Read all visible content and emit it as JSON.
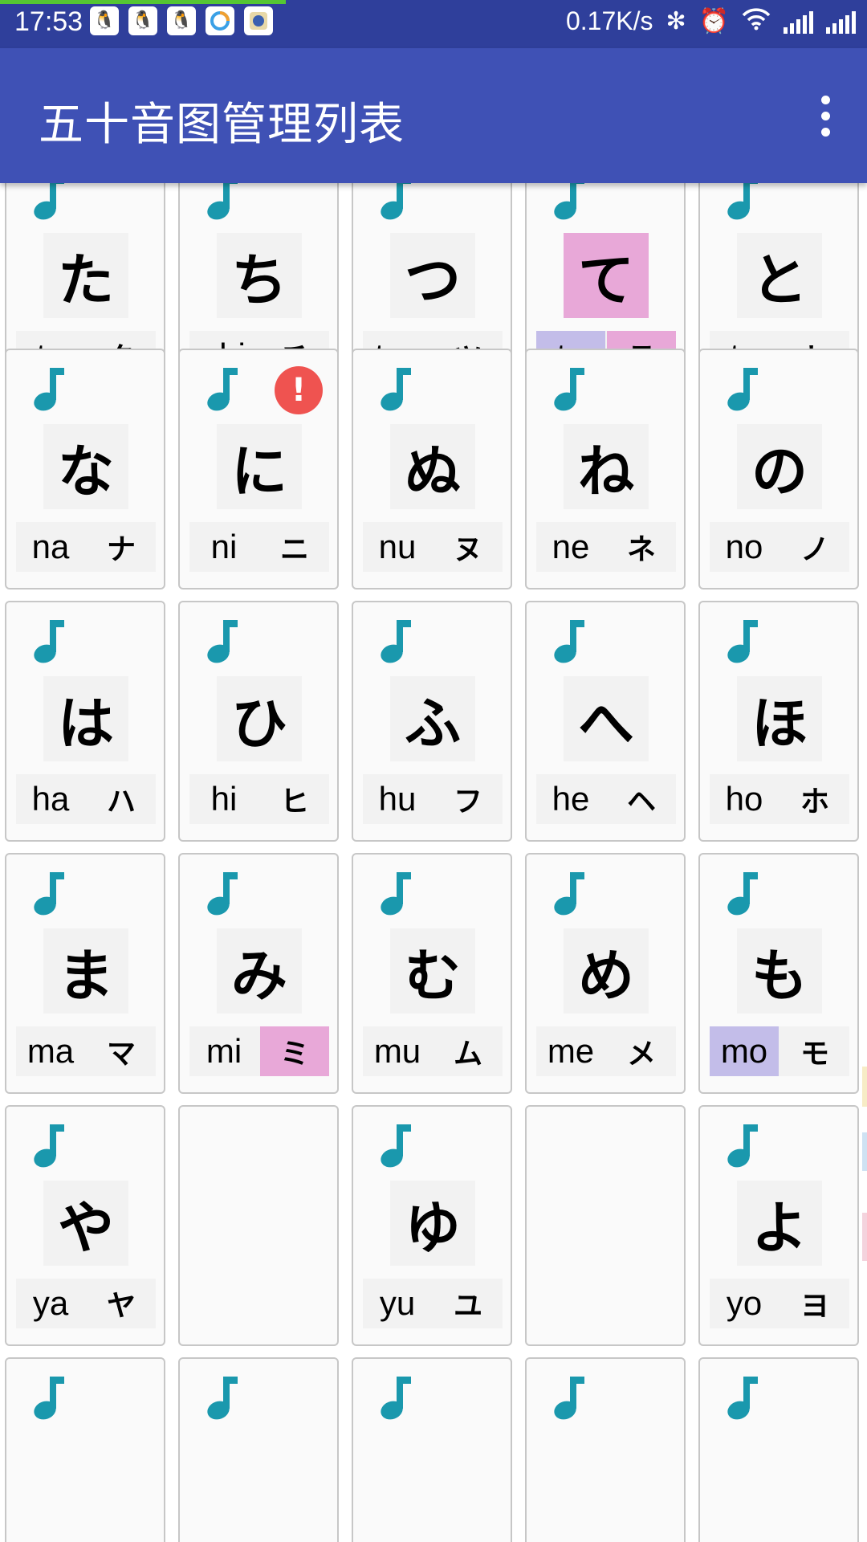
{
  "status_bar": {
    "time": "17:53",
    "progress": 0.33,
    "notification_icons": [
      "qq-icon",
      "qq-icon",
      "qq-icon",
      "ring-app-icon",
      "badge-app-icon"
    ],
    "net_speed": "0.17K/s",
    "bluetooth_glyph": "✻",
    "alarm_glyph": "⏰",
    "wifi_glyph": "◠",
    "background_color": "#2f3f9b",
    "progress_color": "#55c633"
  },
  "app_bar": {
    "title": "五十音图管理列表",
    "background_color": "#3f51b5"
  },
  "grid": {
    "note_color": "#1a98ad",
    "rows": [
      [
        {
          "empty": false,
          "hira": "た",
          "romaji": "ta",
          "kata": "タ"
        },
        {
          "empty": false,
          "hira": "ち",
          "romaji": "chi",
          "kata": "チ"
        },
        {
          "empty": false,
          "hira": "つ",
          "romaji": "tsu",
          "kata": "ツ"
        },
        {
          "empty": false,
          "hira": "て",
          "romaji": "te",
          "kata": "テ",
          "hira_hl": "pink",
          "romaji_hl": "lavender",
          "kata_hl": "pink"
        },
        {
          "empty": false,
          "hira": "と",
          "romaji": "to",
          "kata": "ト"
        }
      ],
      [
        {
          "empty": false,
          "hira": "な",
          "romaji": "na",
          "kata": "ナ"
        },
        {
          "empty": false,
          "hira": "に",
          "romaji": "ni",
          "kata": "ニ",
          "alert": "!"
        },
        {
          "empty": false,
          "hira": "ぬ",
          "romaji": "nu",
          "kata": "ヌ"
        },
        {
          "empty": false,
          "hira": "ね",
          "romaji": "ne",
          "kata": "ネ"
        },
        {
          "empty": false,
          "hira": "の",
          "romaji": "no",
          "kata": "ノ"
        }
      ],
      [
        {
          "empty": false,
          "hira": "は",
          "romaji": "ha",
          "kata": "ハ"
        },
        {
          "empty": false,
          "hira": "ひ",
          "romaji": "hi",
          "kata": "ヒ"
        },
        {
          "empty": false,
          "hira": "ふ",
          "romaji": "hu",
          "kata": "フ"
        },
        {
          "empty": false,
          "hira": "へ",
          "romaji": "he",
          "kata": "ヘ"
        },
        {
          "empty": false,
          "hira": "ほ",
          "romaji": "ho",
          "kata": "ホ"
        }
      ],
      [
        {
          "empty": false,
          "hira": "ま",
          "romaji": "ma",
          "kata": "マ"
        },
        {
          "empty": false,
          "hira": "み",
          "romaji": "mi",
          "kata": "ミ",
          "kata_hl": "pink"
        },
        {
          "empty": false,
          "hira": "む",
          "romaji": "mu",
          "kata": "ム"
        },
        {
          "empty": false,
          "hira": "め",
          "romaji": "me",
          "kata": "メ"
        },
        {
          "empty": false,
          "hira": "も",
          "romaji": "mo",
          "kata": "モ",
          "romaji_hl": "lavender"
        }
      ],
      [
        {
          "empty": false,
          "hira": "や",
          "romaji": "ya",
          "kata": "ヤ"
        },
        {
          "empty": true
        },
        {
          "empty": false,
          "hira": "ゆ",
          "romaji": "yu",
          "kata": "ユ"
        },
        {
          "empty": true
        },
        {
          "empty": false,
          "hira": "よ",
          "romaji": "yo",
          "kata": "ヨ"
        }
      ],
      [
        {
          "empty": false,
          "partial": true
        },
        {
          "empty": false,
          "partial": true
        },
        {
          "empty": false,
          "partial": true
        },
        {
          "empty": false,
          "partial": true
        },
        {
          "empty": false,
          "partial": true
        }
      ]
    ]
  }
}
